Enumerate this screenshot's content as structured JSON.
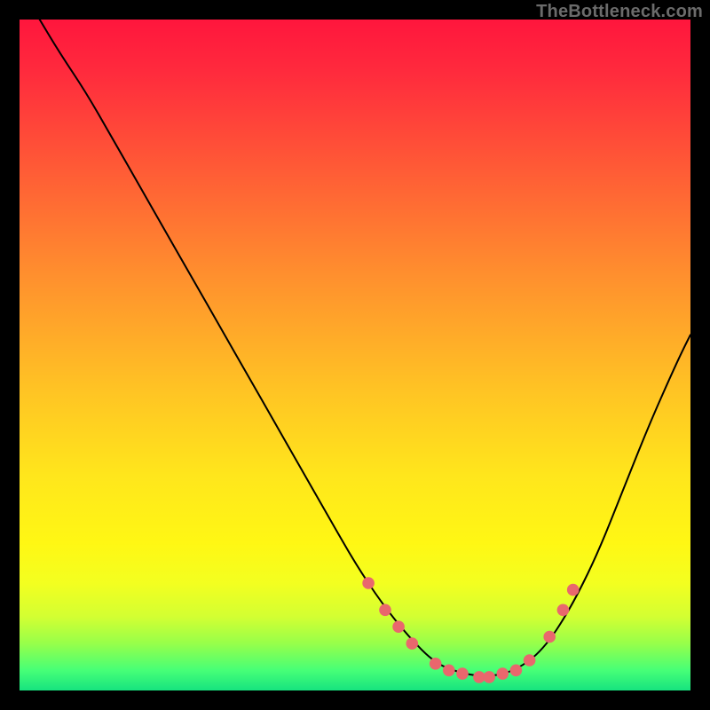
{
  "watermark": "TheBottleneck.com",
  "chart_data": {
    "type": "line",
    "title": "",
    "xlabel": "",
    "ylabel": "",
    "xlim": [
      0,
      100
    ],
    "ylim": [
      0,
      100
    ],
    "grid": false,
    "legend": false,
    "series": [
      {
        "name": "curve",
        "color": "#000000",
        "x": [
          3,
          6,
          10,
          14,
          18,
          22,
          26,
          30,
          34,
          38,
          42,
          46,
          50,
          54,
          58,
          62,
          66,
          70,
          74,
          78,
          82,
          86,
          90,
          94,
          98,
          100
        ],
        "y": [
          100,
          95,
          89,
          82,
          75,
          68,
          61,
          54,
          47,
          40,
          33,
          26,
          19,
          13,
          8,
          4,
          2.5,
          2,
          3,
          6,
          12,
          20,
          30,
          40,
          49,
          53
        ]
      }
    ],
    "markers": {
      "name": "optimal-points",
      "color": "#e9676d",
      "radius_pct": 0.9,
      "x": [
        52,
        54.5,
        56.5,
        58.5,
        62,
        64,
        66,
        68.5,
        70,
        72,
        74,
        76,
        79,
        81,
        82.5
      ],
      "y": [
        16,
        12,
        9.5,
        7,
        4,
        3,
        2.5,
        2,
        2,
        2.5,
        3,
        4.5,
        8,
        12,
        15
      ]
    }
  }
}
